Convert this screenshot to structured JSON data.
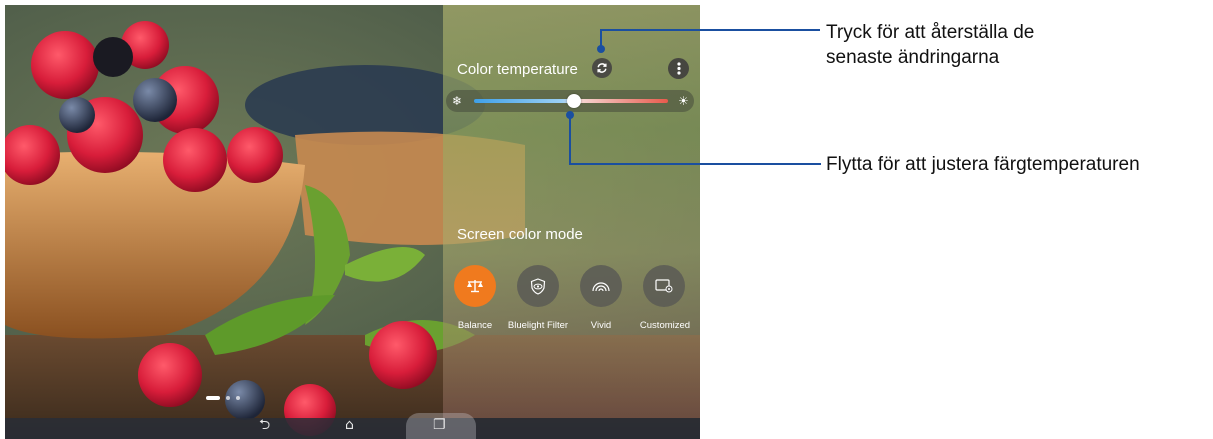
{
  "panel": {
    "color_temperature_label": "Color temperature",
    "screen_color_mode_label": "Screen color mode"
  },
  "slider": {
    "value": 0.5,
    "cold_icon": "snowflake-icon",
    "warm_icon": "sun-icon"
  },
  "modes": [
    {
      "label": "Balance",
      "icon": "scale-icon",
      "active": true
    },
    {
      "label": "Bluelight Filter",
      "icon": "eye-shield-icon",
      "active": false
    },
    {
      "label": "Vivid",
      "icon": "rainbow-icon",
      "active": false
    },
    {
      "label": "Customized",
      "icon": "custom-screen-icon",
      "active": false
    }
  ],
  "callouts": {
    "reset": "Tryck för att återställa de senaste ändringarna",
    "adjust": "Flytta för att justera färgtemperaturen"
  },
  "navbar": {
    "back_icon": "back-icon",
    "home_icon": "home-icon",
    "recent_icon": "recent-apps-icon"
  },
  "colors": {
    "accent": "#f07a1e",
    "callout": "#1a4fa0"
  }
}
